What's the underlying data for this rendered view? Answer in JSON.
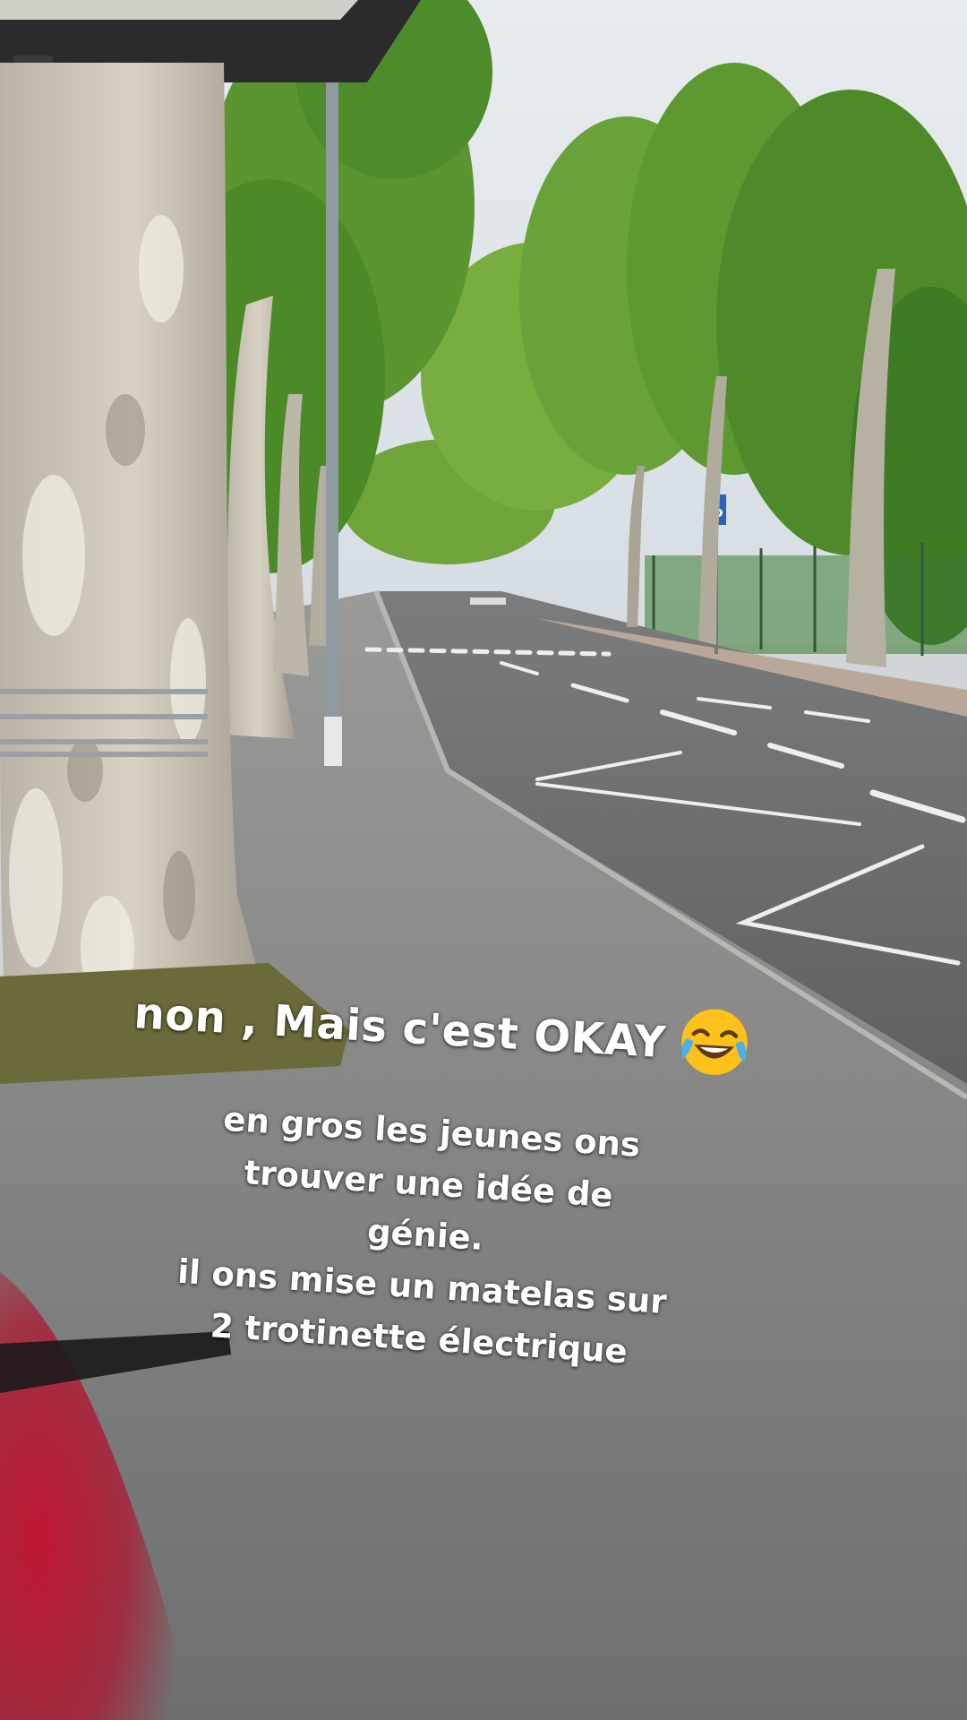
{
  "overlay": {
    "headline": "non , Mais c'est OKAY",
    "headline_emoji": "face-with-tears-of-joy-icon",
    "body_lines": [
      "en gros les jeunes ons",
      "trouver une idée de",
      "génie.",
      "il ons mise un matelas sur",
      "2 trotinette électrique"
    ]
  },
  "scene": {
    "description_icon": "street-photo",
    "parking_sign": "P",
    "colors": {
      "sky": "#dfe5ea",
      "foliage": "#5f9a2e",
      "road": "#6d6f70",
      "sidewalk": "#8a8a88",
      "bark": "#c9c3b4",
      "accent_red": "#c0142a"
    }
  }
}
